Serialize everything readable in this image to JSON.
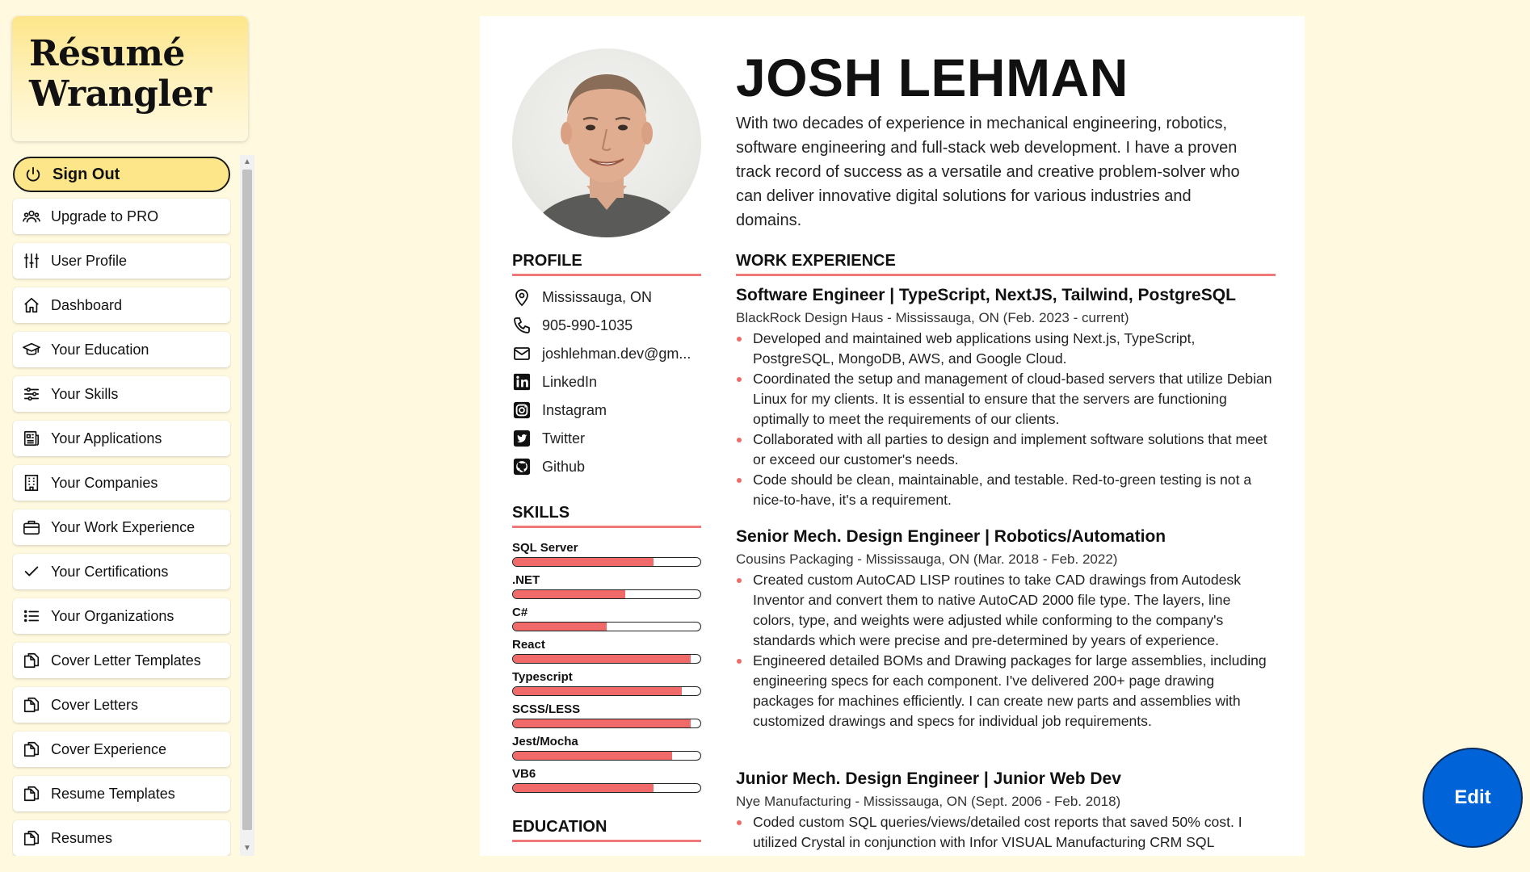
{
  "app": {
    "logo_line1": "Résumé",
    "logo_line2": "Wrangler"
  },
  "sidebar": {
    "items": [
      {
        "label": "Sign Out",
        "icon": "power-icon"
      },
      {
        "label": "Upgrade to PRO",
        "icon": "users-icon"
      },
      {
        "label": "User Profile",
        "icon": "sliders-icon"
      },
      {
        "label": "Dashboard",
        "icon": "home-icon"
      },
      {
        "label": "Your Education",
        "icon": "graduation-cap-icon"
      },
      {
        "label": "Your Skills",
        "icon": "adjustments-icon"
      },
      {
        "label": "Your Applications",
        "icon": "newspaper-icon"
      },
      {
        "label": "Your Companies",
        "icon": "building-icon"
      },
      {
        "label": "Your Work Experience",
        "icon": "briefcase-icon"
      },
      {
        "label": "Your Certifications",
        "icon": "check-icon"
      },
      {
        "label": "Your Organizations",
        "icon": "list-icon"
      },
      {
        "label": "Cover Letter Templates",
        "icon": "copy-icon"
      },
      {
        "label": "Cover Letters",
        "icon": "copy-icon"
      },
      {
        "label": "Cover Experience",
        "icon": "copy-icon"
      },
      {
        "label": "Resume Templates",
        "icon": "copy-icon"
      },
      {
        "label": "Resumes",
        "icon": "copy-icon"
      }
    ]
  },
  "resume": {
    "name": "JOSH LEHMAN",
    "summary": "With two decades of experience in mechanical engineering, robotics, software engineering and full-stack web development. I have a proven track record of success as a versatile and creative problem-solver who can deliver innovative digital solutions for various industries and domains.",
    "profile_title": "PROFILE",
    "contacts": [
      {
        "label": "Mississauga, ON",
        "icon": "map-pin-icon"
      },
      {
        "label": "905-990-1035",
        "icon": "phone-icon"
      },
      {
        "label": "joshlehman.dev@gm...",
        "icon": "mail-icon"
      },
      {
        "label": "LinkedIn",
        "icon": "linkedin-icon"
      },
      {
        "label": "Instagram",
        "icon": "instagram-icon"
      },
      {
        "label": "Twitter",
        "icon": "twitter-icon"
      },
      {
        "label": "Github",
        "icon": "github-icon"
      }
    ],
    "skills_title": "SKILLS",
    "skills": [
      {
        "name": "SQL Server",
        "level": 0.75
      },
      {
        "name": ".NET",
        "level": 0.6
      },
      {
        "name": "C#",
        "level": 0.5
      },
      {
        "name": "React",
        "level": 0.95
      },
      {
        "name": "Typescript",
        "level": 0.9
      },
      {
        "name": "SCSS/LESS",
        "level": 0.95
      },
      {
        "name": "Jest/Mocha",
        "level": 0.85
      },
      {
        "name": "VB6",
        "level": 0.75
      }
    ],
    "education_title": "EDUCATION",
    "work_title": "WORK EXPERIENCE",
    "jobs": [
      {
        "title": "Software Engineer | TypeScript, NextJS, Tailwind, PostgreSQL",
        "sub": "BlackRock Design Haus - Mississauga, ON (Feb. 2023 - current)",
        "bullets": [
          "Developed and maintained web applications using Next.js, TypeScript, PostgreSQL, MongoDB, AWS, and Google Cloud.",
          "Coordinated the setup and management of cloud-based servers that utilize Debian Linux for my clients. It is essential to ensure that the servers are functioning optimally to meet the requirements of our clients.",
          "Collaborated with all parties to design and implement software solutions that meet or exceed our customer's needs.",
          "Code should be clean, maintainable, and testable. Red-to-green testing is not a nice-to-have, it's a requirement."
        ]
      },
      {
        "title": "Senior Mech. Design Engineer | Robotics/Automation",
        "sub": "Cousins Packaging - Mississauga, ON (Mar. 2018 - Feb. 2022)",
        "bullets": [
          "Created custom AutoCAD LISP routines to take CAD drawings from Autodesk Inventor and convert them to native AutoCAD 2000 file type. The layers, line colors, type, and weights were adjusted while conforming to the company's standards which were precise and pre-determined by years of experience.",
          "Engineered detailed BOMs and Drawing packages for large assemblies, including engineering specs for each component. I've delivered 200+ page drawing packages for machines efficiently. I can create new parts and assemblies with customized drawings and specs for individual job requirements."
        ]
      },
      {
        "title": "Junior Mech. Design Engineer | Junior Web Dev",
        "sub": "Nye Manufacturing - Mississauga, ON (Sept. 2006 - Feb. 2018)",
        "bullets": [
          "Coded custom SQL queries/views/detailed cost reports that saved 50% cost. I utilized Crystal in conjunction with Infor VISUAL Manufacturing CRM SQL"
        ]
      }
    ]
  },
  "edit_button": {
    "label": "Edit"
  },
  "colors": {
    "accent": "#f06a6a",
    "logo_yellow": "#fde68a",
    "edit_blue": "#0064d8",
    "background": "#fff9e0"
  }
}
